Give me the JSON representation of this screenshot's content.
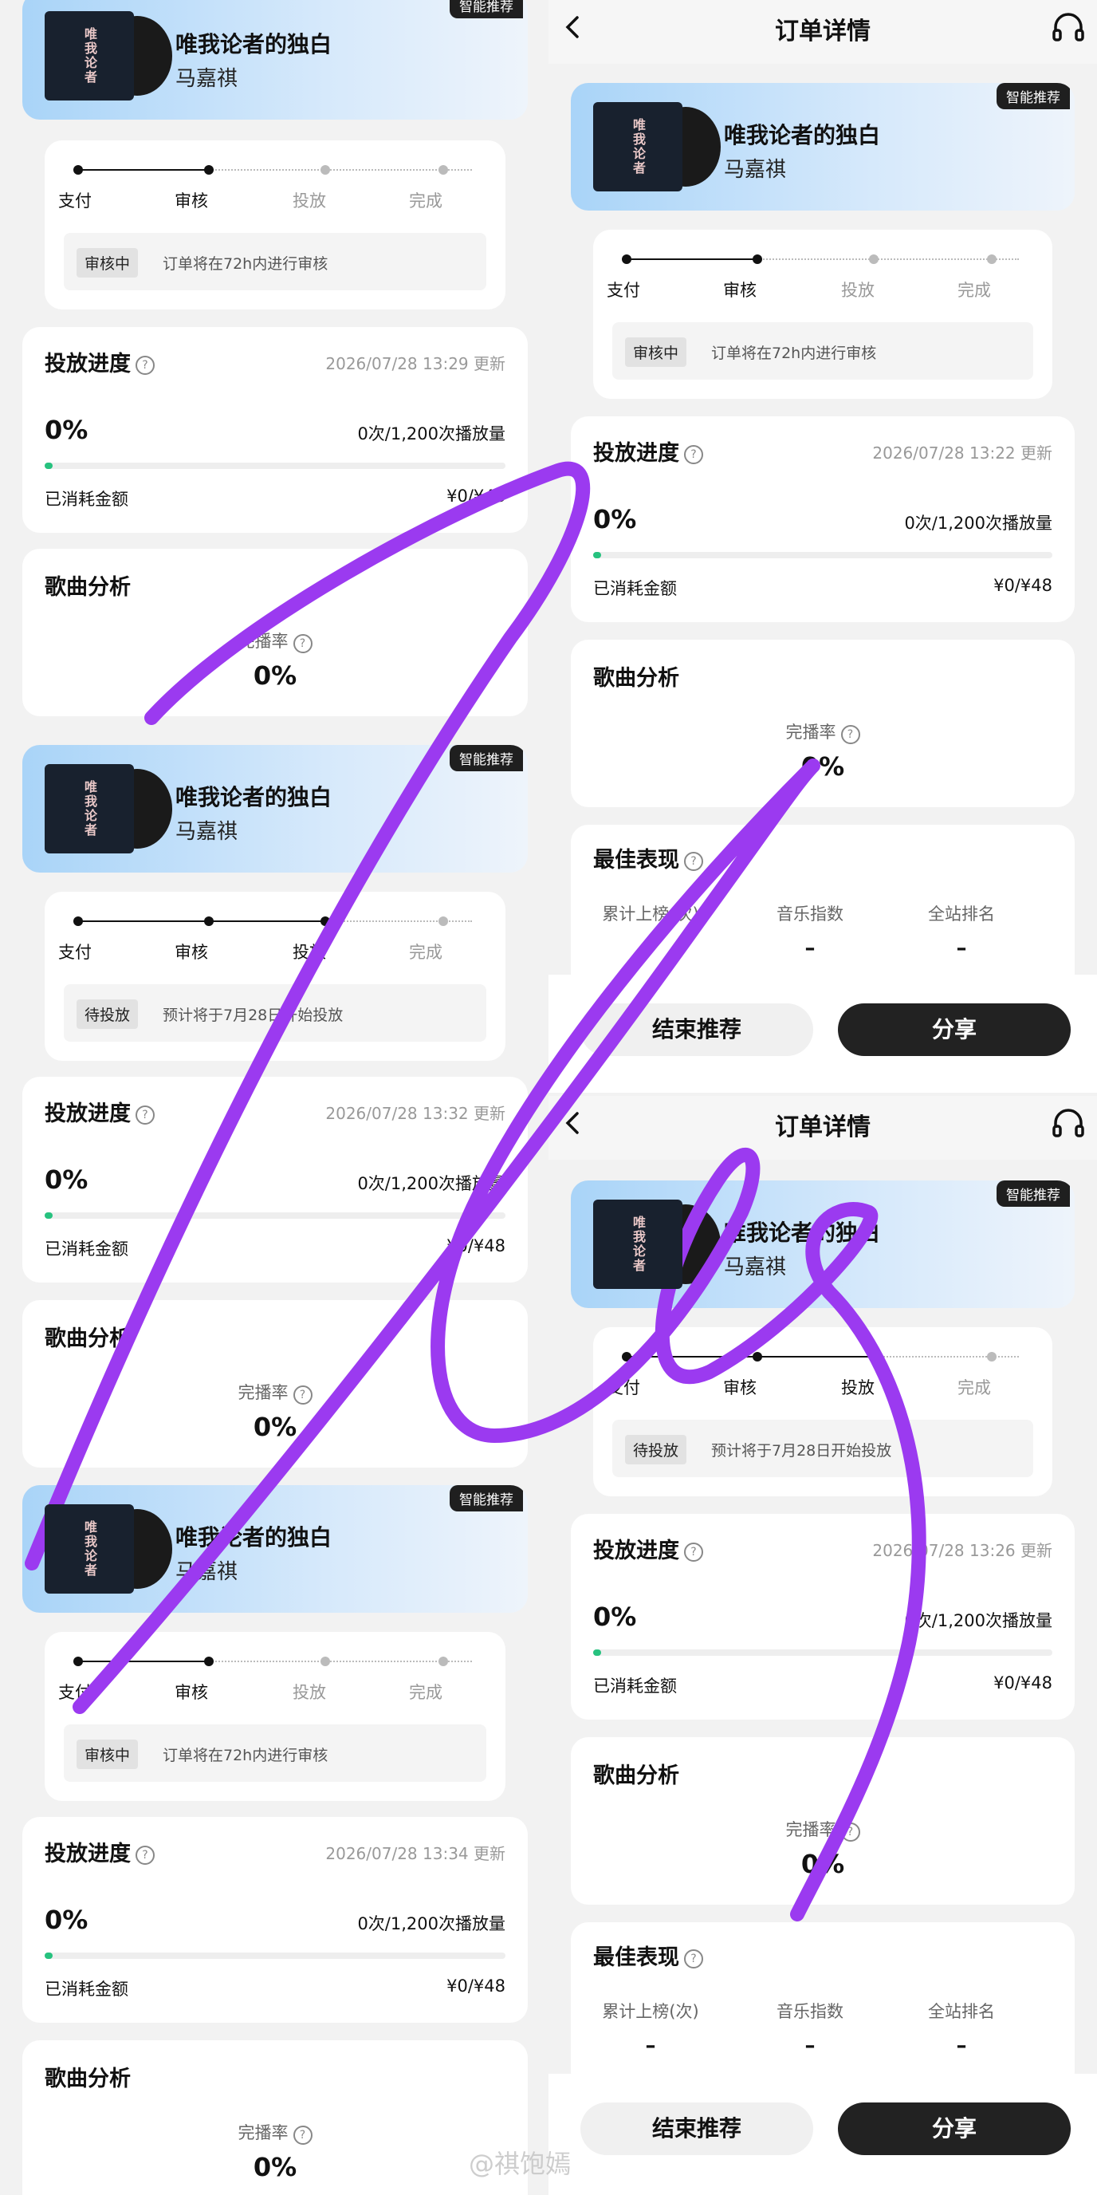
{
  "song": {
    "name": "唯我论者的独白",
    "artist": "马嘉祺",
    "cover_text": "唯我论者",
    "badge": "智能推荐"
  },
  "header": {
    "title": "订单详情"
  },
  "steps": [
    "支付",
    "审核",
    "投放",
    "完成"
  ],
  "notes": {
    "review": {
      "tag": "审核中",
      "text": "订单将在72h内进行审核"
    },
    "pending": {
      "tag": "待投放",
      "text": "预计将于7月28日开始投放"
    }
  },
  "progress": {
    "title": "投放进度",
    "percent": "0%",
    "percent_value": 0,
    "plays": "0次/1,200次播放量",
    "spent_label": "已消耗金额",
    "spent_value": "¥0/¥48"
  },
  "updates": {
    "L1": "2026/07/28 13:29 更新",
    "L2": "2026/07/28 13:32 更新",
    "L3": "2026/07/28 13:34 更新",
    "R1": "2026/07/28 13:22 更新",
    "R2": "2026/07/28 13:26 更新"
  },
  "analysis": {
    "title": "歌曲分析",
    "rate_label": "完播率",
    "rate_value": "0%"
  },
  "best": {
    "title": "最佳表现",
    "cols": [
      {
        "label": "累计上榜(次)",
        "value": "–"
      },
      {
        "label": "音乐指数",
        "value": "–"
      },
      {
        "label": "全站排名",
        "value": "–"
      }
    ]
  },
  "buttons": {
    "end": "结束推荐",
    "share": "分享"
  },
  "watermark": "@祺饱嫣",
  "colors": {
    "accent_green": "#27c27f",
    "scribble": "#9b3af0"
  }
}
